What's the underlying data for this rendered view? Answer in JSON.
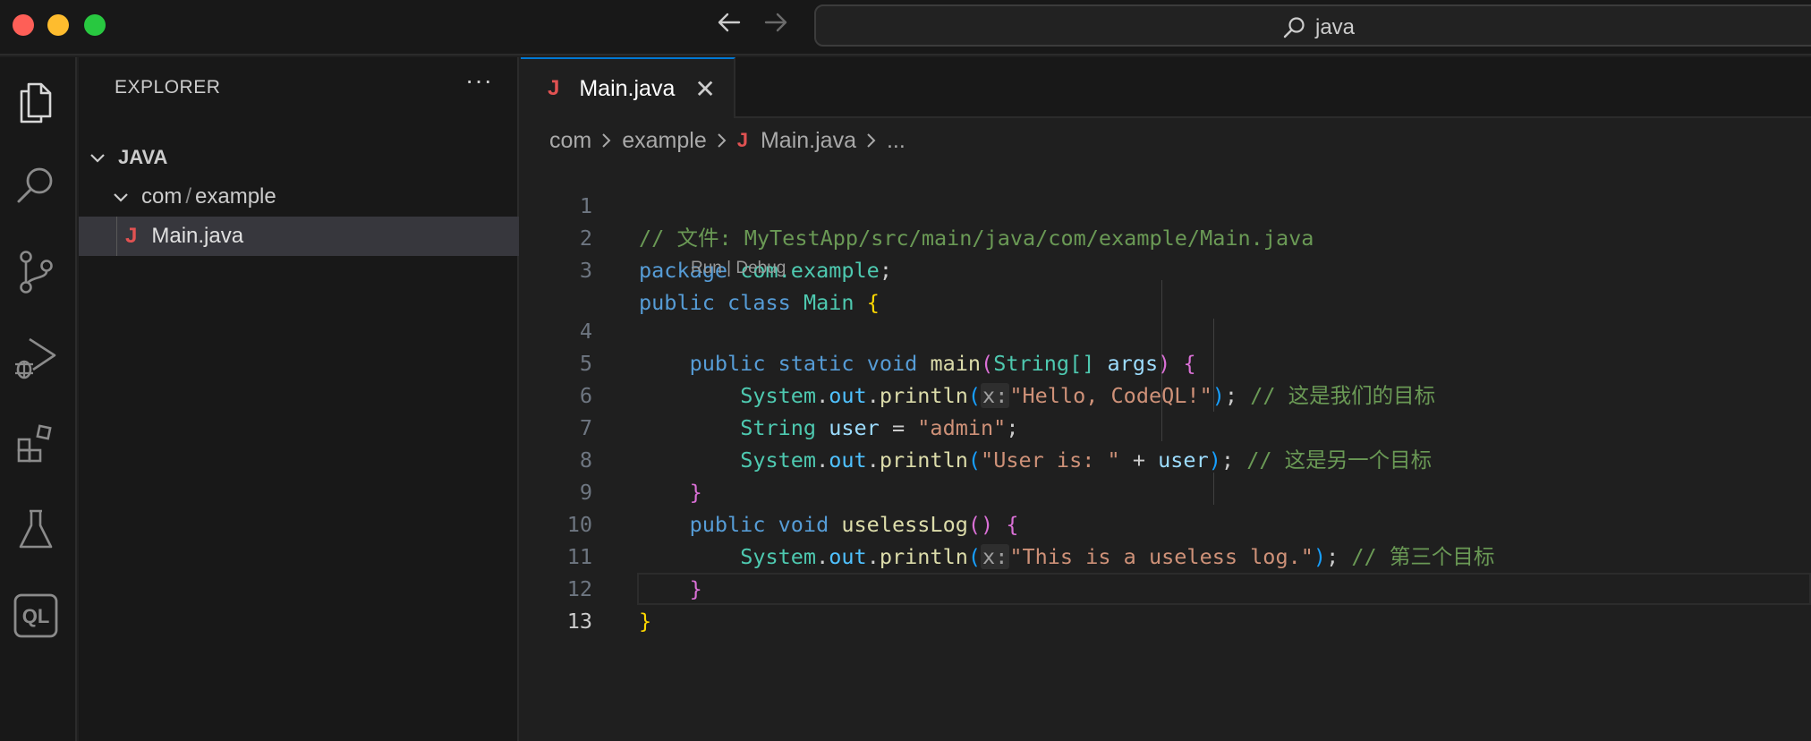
{
  "titlebar": {
    "search_text": "java"
  },
  "sidebar": {
    "title": "EXPLORER",
    "more": "···",
    "root": "JAVA",
    "folder_part1": "com",
    "folder_sep": "/",
    "folder_part2": "example",
    "file": "Main.java",
    "file_icon": "J"
  },
  "editor": {
    "tab_label": "Main.java",
    "tab_icon": "J",
    "tab_close": "✕",
    "breadcrumb": [
      "com",
      "example",
      "Main.java",
      "..."
    ],
    "codelens": "Run | Debug",
    "line_numbers": [
      "1",
      "2",
      "3",
      "4",
      "5",
      "6",
      "7",
      "8",
      "9",
      "10",
      "11",
      "12",
      "13"
    ],
    "code": {
      "l1": "// 文件: MyTestApp/src/main/java/com/example/Main.java",
      "l2_kw": "package",
      "l2_pkg": "com.example",
      "l2_end": ";",
      "l3_kw1": "public",
      "l3_kw2": "class",
      "l3_name": "Main",
      "l3_brace": "{",
      "l4_kw1": "public",
      "l4_kw2": "static",
      "l4_kw3": "void",
      "l4_fn": "main",
      "l4_open": "(",
      "l4_type": "String[]",
      "l4_param": "args",
      "l4_close": ")",
      "l4_brace": "{",
      "sys": "System",
      "dot": ".",
      "out": "out",
      "println": "println",
      "hint_x": "x:",
      "l5_str": "\"Hello, CodeQL!\"",
      "l5_comment": "// 这是我们的目标",
      "l6_type": "String",
      "l6_var": "user",
      "l6_eq": " = ",
      "l6_str": "\"admin\"",
      "l6_end": ";",
      "l7_str": "\"User is: \"",
      "l7_plus": " + ",
      "l7_var": "user",
      "l7_comment": "// 这是另一个目标",
      "l8_brace": "}",
      "l9_kw1": "public",
      "l9_kw2": "void",
      "l9_fn": "uselessLog",
      "l9_parens": "()",
      "l9_brace": "{",
      "l10_str": "\"This is a useless log.\"",
      "l10_comment": "// 第三个目标",
      "l11_brace": "}",
      "l12_brace": "}",
      "semi": ";"
    }
  },
  "colors": {
    "accent": "#0078d4",
    "java_icon": "#e05252"
  }
}
